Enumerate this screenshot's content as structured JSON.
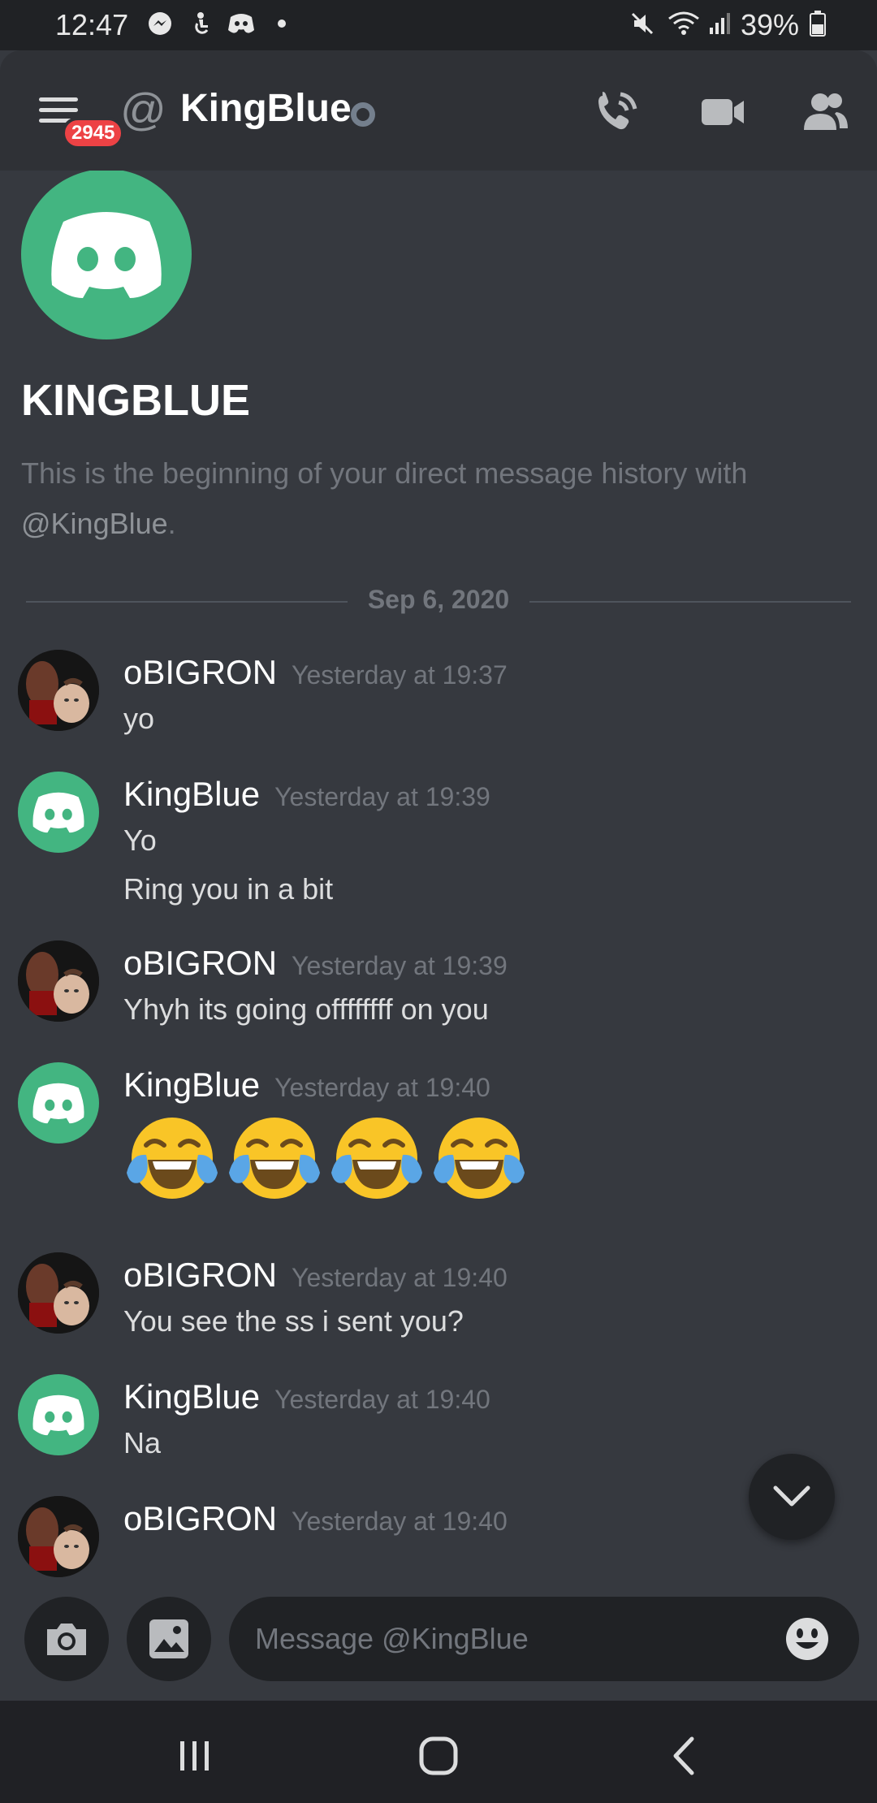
{
  "status_bar": {
    "time": "12:47",
    "battery": "39%",
    "icons": [
      "messenger-icon",
      "accessibility-icon",
      "discord-icon",
      "dot-icon",
      "mute-icon",
      "wifi-icon",
      "signal-icon",
      "battery-icon"
    ]
  },
  "header": {
    "mention_count": "2945",
    "at": "@",
    "channel_name": "KingBlue",
    "status": "offline",
    "actions": [
      "voice-call-icon",
      "video-call-icon",
      "members-icon"
    ]
  },
  "intro": {
    "title": "KINGBLUE",
    "description": "This is the beginning of your direct message history with",
    "mention": "@KingBlue",
    "period": "."
  },
  "date_divider": "Sep 6, 2020",
  "messages": [
    {
      "author": "oBIGRON",
      "timestamp": "Yesterday at 19:37",
      "lines": [
        "yo"
      ],
      "avatar": "photo"
    },
    {
      "author": "KingBlue",
      "timestamp": "Yesterday at 19:39",
      "lines": [
        "Yo",
        "Ring you in a bit"
      ],
      "avatar": "discord"
    },
    {
      "author": "oBIGRON",
      "timestamp": "Yesterday at 19:39",
      "lines": [
        "Yhyh its going offffffff on you"
      ],
      "avatar": "photo"
    },
    {
      "author": "KingBlue",
      "timestamp": "Yesterday at 19:40",
      "emojis": [
        "face-with-tears-of-joy",
        "face-with-tears-of-joy",
        "face-with-tears-of-joy",
        "face-with-tears-of-joy"
      ],
      "avatar": "discord"
    },
    {
      "author": "oBIGRON",
      "timestamp": "Yesterday at 19:40",
      "lines": [
        "You see the ss i sent you?"
      ],
      "avatar": "photo"
    },
    {
      "author": "KingBlue",
      "timestamp": "Yesterday at 19:40",
      "lines": [
        "Na"
      ],
      "avatar": "discord"
    },
    {
      "author": "oBIGRON",
      "timestamp": "Yesterday at 19:40",
      "lines": [],
      "avatar": "photo"
    }
  ],
  "input": {
    "placeholder": "Message @KingBlue",
    "value": ""
  },
  "colors": {
    "accent_green": "#43b581",
    "badge_red": "#ed4245",
    "background": "#36393f",
    "header": "#2f3136",
    "dark": "#202225"
  }
}
